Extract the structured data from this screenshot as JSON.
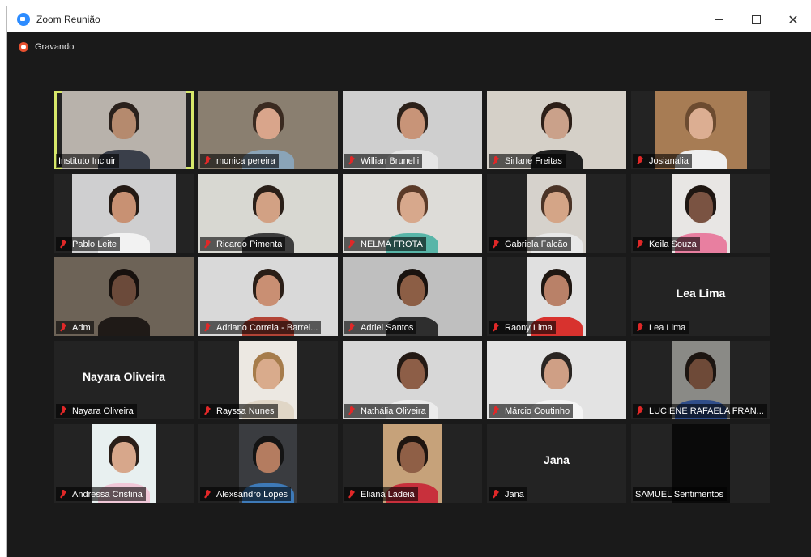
{
  "window": {
    "title": "Zoom Reunião"
  },
  "recording": {
    "label": "Gravando"
  },
  "participants": [
    {
      "name": "Instituto Incluir",
      "muted": false,
      "video": true,
      "active": true,
      "bg": "#b8b2ab",
      "skin": "#b58a6e",
      "hair": "#2a211c",
      "shirt": "#3a3f4a"
    },
    {
      "name": "monica pereira",
      "muted": true,
      "video": true,
      "bg": "#8a7f70",
      "skin": "#d9a58b",
      "hair": "#3a2a20",
      "shirt": "#8aa4b8"
    },
    {
      "name": "Willian Brunelli",
      "muted": true,
      "video": true,
      "bg": "#cfcfcf",
      "skin": "#c89478",
      "hair": "#2b2019",
      "shirt": "#e5e5e5"
    },
    {
      "name": "Sirlane Freitas",
      "muted": true,
      "video": true,
      "bg": "#d5d0c8",
      "skin": "#caa18a",
      "hair": "#2c1f18",
      "shirt": "#1f1f1f"
    },
    {
      "name": "Josianalia",
      "muted": true,
      "video": true,
      "bg": "#a77c54",
      "skin": "#dcae92",
      "hair": "#6c4b30",
      "shirt": "#efefef"
    },
    {
      "name": "Pablo Leite",
      "muted": true,
      "video": true,
      "bg": "#cfcfd0",
      "skin": "#c89173",
      "hair": "#241a14",
      "shirt": "#f2f2f2"
    },
    {
      "name": "Ricardo Pimenta",
      "muted": true,
      "video": true,
      "bg": "#d8d8d2",
      "skin": "#d2a184",
      "hair": "#2a1f18",
      "shirt": "#3d3d3d"
    },
    {
      "name": "NELMA FROTA",
      "muted": true,
      "video": true,
      "bg": "#dddcd8",
      "skin": "#d7a88c",
      "hair": "#5a3a28",
      "shirt": "#58b5a8"
    },
    {
      "name": "Gabriela Falcão",
      "muted": true,
      "video": true,
      "bg": "#d6d2cc",
      "skin": "#d4a587",
      "hair": "#4a3326",
      "shirt": "#e8e8e8"
    },
    {
      "name": "Keila Souza",
      "muted": true,
      "video": true,
      "bg": "#e8e6e4",
      "skin": "#7a5342",
      "hair": "#1e1612",
      "shirt": "#e87fa0"
    },
    {
      "name": "Adm",
      "muted": true,
      "video": true,
      "bg": "#6d6357",
      "skin": "#6b4a3a",
      "hair": "#17110e",
      "shirt": "#1f1a17"
    },
    {
      "name": "Adriano Correia - Barrei...",
      "muted": true,
      "video": true,
      "bg": "#d9d9d9",
      "skin": "#c98f73",
      "hair": "#2a1e17",
      "shirt": "#b24436"
    },
    {
      "name": "Adriel Santos",
      "muted": true,
      "video": true,
      "bg": "#bfbfbf",
      "skin": "#8c5e45",
      "hair": "#1a130f",
      "shirt": "#2e2e2e"
    },
    {
      "name": "Raony Lima",
      "muted": true,
      "video": true,
      "bg": "#e0e0e0",
      "skin": "#b98168",
      "hair": "#1f1712",
      "shirt": "#d8322e"
    },
    {
      "name": "Lea Lima",
      "muted": true,
      "video": false
    },
    {
      "name": "Nayara Oliveira",
      "muted": true,
      "video": false
    },
    {
      "name": "Rayssa Nunes",
      "muted": true,
      "video": true,
      "bg": "#ece8e2",
      "skin": "#d9ab8c",
      "hair": "#a67c4b",
      "shirt": "#e0d6c6"
    },
    {
      "name": "Nathália Oliveira",
      "muted": true,
      "video": true,
      "bg": "#d7d7d7",
      "skin": "#8d5e47",
      "hair": "#231914",
      "shirt": "#ebebeb"
    },
    {
      "name": "Márcio Coutinho",
      "muted": true,
      "video": true,
      "bg": "#e3e3e3",
      "skin": "#cf9f85",
      "hair": "#2a2522",
      "shirt": "#f4f4f4"
    },
    {
      "name": "LUCIENE RAFAELA FRAN...",
      "muted": true,
      "video": true,
      "bg": "#8a8a86",
      "skin": "#6e4a38",
      "hair": "#1c1511",
      "shirt": "#2f4d8a"
    },
    {
      "name": "Andressa Cristina",
      "muted": true,
      "video": true,
      "bg": "#e8f0f0",
      "skin": "#d7a78b",
      "hair": "#2a1e18",
      "shirt": "#f0c8d8"
    },
    {
      "name": "Alexsandro Lopes",
      "muted": true,
      "video": true,
      "bg": "#3a3c40",
      "skin": "#b47c60",
      "hair": "#141414",
      "shirt": "#3e7ab8"
    },
    {
      "name": "Eliana Ladeia",
      "muted": true,
      "video": true,
      "bg": "#c6a27a",
      "skin": "#8f5f46",
      "hair": "#1e1510",
      "shirt": "#c8303c"
    },
    {
      "name": "Jana",
      "muted": true,
      "video": false
    },
    {
      "name": "SAMUEL Sentimentos",
      "muted": false,
      "video": true,
      "dark": true,
      "bg": "#0a0a0a"
    }
  ],
  "icons": {
    "mic_muted": "mic-muted-icon",
    "recording": "recording-icon",
    "app": "zoom-icon"
  }
}
